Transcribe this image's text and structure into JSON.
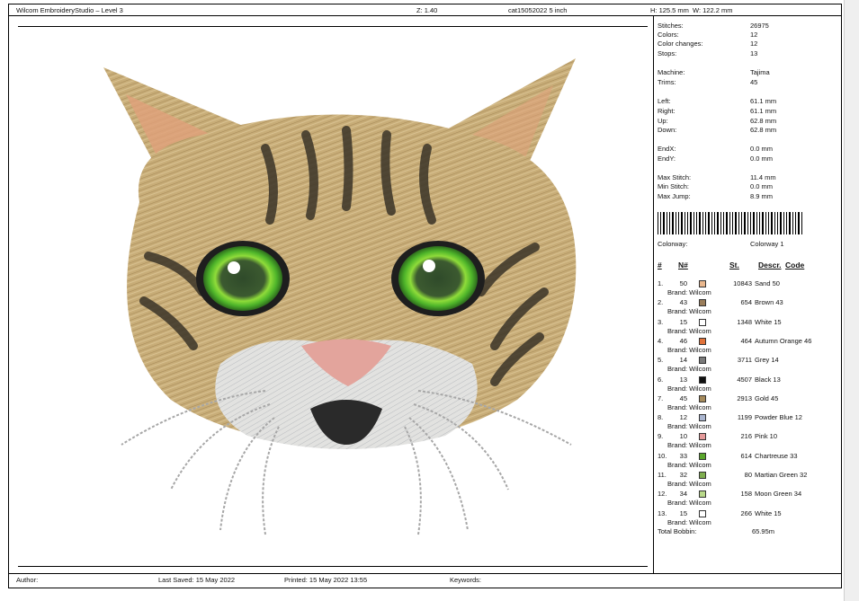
{
  "header": {
    "app_title": "Wilcom EmbroideryStudio – Level 3",
    "zoom": "Z: 1.40",
    "filename": "cat15052022 5 inch",
    "height": "H: 125.5 mm",
    "width": "W: 122.2 mm"
  },
  "stats": [
    {
      "label": "Stitches:",
      "value": "26975"
    },
    {
      "label": "Colors:",
      "value": "12"
    },
    {
      "label": "Color changes:",
      "value": "12"
    },
    {
      "label": "Stops:",
      "value": "13"
    },
    {
      "label": "Machine:",
      "value": "Tajima"
    },
    {
      "label": "Trims:",
      "value": "45"
    },
    {
      "label": "Left:",
      "value": "61.1 mm"
    },
    {
      "label": "Right:",
      "value": "61.1 mm"
    },
    {
      "label": "Up:",
      "value": "62.8 mm"
    },
    {
      "label": "Down:",
      "value": "62.8 mm"
    },
    {
      "label": "EndX:",
      "value": "0.0 mm"
    },
    {
      "label": "EndY:",
      "value": "0.0 mm"
    },
    {
      "label": "Max Stitch:",
      "value": "11.4 mm"
    },
    {
      "label": "Min Stitch:",
      "value": "0.0 mm"
    },
    {
      "label": "Max Jump:",
      "value": "8.9 mm"
    }
  ],
  "colorway": {
    "label": "Colorway:",
    "value": "Colorway 1"
  },
  "table_headers": {
    "num": "#",
    "n": "N#",
    "st": "St.",
    "desc": "Descr.",
    "code": "Code"
  },
  "colors": [
    {
      "num": "1.",
      "n": "50",
      "color": "#e9b78d",
      "st": "10843",
      "desc": "Sand 50",
      "brand": "Brand: Wilcom"
    },
    {
      "num": "2.",
      "n": "43",
      "color": "#9a7d5a",
      "st": "654",
      "desc": "Brown 43",
      "brand": "Brand: Wilcom"
    },
    {
      "num": "3.",
      "n": "15",
      "color": "#ffffff",
      "st": "1348",
      "desc": "White 15",
      "brand": "Brand: Wilcom"
    },
    {
      "num": "4.",
      "n": "46",
      "color": "#e0723a",
      "st": "464",
      "desc": "Autumn Orange 46",
      "brand": "Brand: Wilcom"
    },
    {
      "num": "5.",
      "n": "14",
      "color": "#7a7a7a",
      "st": "3711",
      "desc": "Grey 14",
      "brand": "Brand: Wilcom"
    },
    {
      "num": "6.",
      "n": "13",
      "color": "#111111",
      "st": "4507",
      "desc": "Black 13",
      "brand": "Brand: Wilcom"
    },
    {
      "num": "7.",
      "n": "45",
      "color": "#a58a5b",
      "st": "2913",
      "desc": "Gold 45",
      "brand": "Brand: Wilcom"
    },
    {
      "num": "8.",
      "n": "12",
      "color": "#aab5cf",
      "st": "1199",
      "desc": "Powder Blue 12",
      "brand": "Brand: Wilcom"
    },
    {
      "num": "9.",
      "n": "10",
      "color": "#e59a9a",
      "st": "216",
      "desc": "Pink 10",
      "brand": "Brand: Wilcom"
    },
    {
      "num": "10.",
      "n": "33",
      "color": "#5aa62b",
      "st": "614",
      "desc": "Chartreuse 33",
      "brand": "Brand: Wilcom"
    },
    {
      "num": "11.",
      "n": "32",
      "color": "#7fae4f",
      "st": "80",
      "desc": "Martian Green 32",
      "brand": "Brand: Wilcom"
    },
    {
      "num": "12.",
      "n": "34",
      "color": "#b9d98a",
      "st": "158",
      "desc": "Moon Green 34",
      "brand": "Brand: Wilcom"
    },
    {
      "num": "13.",
      "n": "15",
      "color": "#ffffff",
      "st": "266",
      "desc": "White 15",
      "brand": "Brand: Wilcom"
    }
  ],
  "total_bobbin": {
    "label": "Total Bobbin:",
    "value": "65.95m"
  },
  "footer": {
    "author": "Author:",
    "last_saved": "Last Saved: 15 May 2022",
    "printed": "Printed: 15 May 2022 13:55",
    "keywords": "Keywords:"
  }
}
